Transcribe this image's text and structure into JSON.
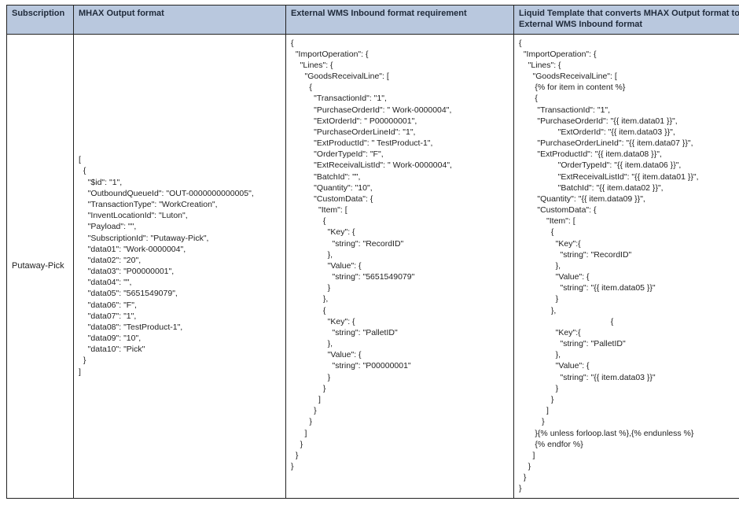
{
  "headers": {
    "col1": "Subscription",
    "col2": "MHAX Output format",
    "col3": "External WMS Inbound format requirement",
    "col4": "Liquid Template that converts MHAX Output format to External WMS Inbound format"
  },
  "row": {
    "subscription": "Putaway-Pick",
    "mhax": "[\n  {\n    \"$id\": \"1\",\n    \"OutboundQueueId\": \"OUT-0000000000005\",\n    \"TransactionType\": \"WorkCreation\",\n    \"InventLocationId\": \"Luton\",\n    \"Payload\": \"\",\n    \"SubscriptionId\": \"Putaway-Pick\",\n    \"data01\": \"Work-0000004\",\n    \"data02\": \"20\",\n    \"data03\": \"P00000001\",\n    \"data04\": \"\",\n    \"data05\": \"5651549079\",\n    \"data06\": \"F\",\n    \"data07\": \"1\",\n    \"data08\": \"TestProduct-1\",\n    \"data09\": \"10\",\n    \"data10\": \"Pick\"\n  }\n]",
    "external": "{\n  \"ImportOperation\": {\n    \"Lines\": {\n      \"GoodsReceivalLine\": [\n        {\n          \"TransactionId\": \"1\",\n          \"PurchaseOrderId\": \" Work-0000004\",\n          \"ExtOrderId\": \" P00000001\",\n          \"PurchaseOrderLineId\": \"1\",\n          \"ExtProductId\": \" TestProduct-1\",\n          \"OrderTypeId\": \"F\",\n          \"ExtReceivalListId\": \" Work-0000004\",\n          \"BatchId\": \"\",\n          \"Quantity\": \"10\",\n          \"CustomData\": {\n            \"Item\": [\n              {\n                \"Key\": {\n                  \"string\": \"RecordID\"\n                },\n                \"Value\": {\n                  \"string\": \"5651549079\"\n                }\n              },\n              {\n                \"Key\": {\n                  \"string\": \"PalletID\"\n                },\n                \"Value\": {\n                  \"string\": \"P00000001\"\n                }\n              }\n            ]\n          }\n        }\n      ]\n    }\n  }\n}",
    "liquid": "{\n  \"ImportOperation\": {\n    \"Lines\": {\n      \"GoodsReceivalLine\": [\n       {% for item in content %}\n       {\n        \"TransactionId\": \"1\",\n        \"PurchaseOrderId\": \"{{ item.data01 }}\",\n                 \"ExtOrderId\": \"{{ item.data03 }}\",\n        \"PurchaseOrderLineId\": \"{{ item.data07 }}\",\n        \"ExtProductId\": \"{{ item.data08 }}\",\n                 \"OrderTypeId\": \"{{ item.data06 }}\",\n                 \"ExtReceivalListId\": \"{{ item.data01 }}\",\n                 \"BatchId\": \"{{ item.data02 }}\",\n        \"Quantity\": \"{{ item.data09 }}\",\n        \"CustomData\": {\n            \"Item\": [\n              {\n                \"Key\":{\n                  \"string\": \"RecordID\"\n                },\n                \"Value\": {\n                  \"string\": \"{{ item.data05 }}\"\n                }\n              },\n                                        {\n                \"Key\":{\n                  \"string\": \"PalletID\"\n                },\n                \"Value\": {\n                  \"string\": \"{{ item.data03 }}\"\n                }\n              }\n            ]\n          }\n       }{% unless forloop.last %},{% endunless %}\n       {% endfor %}\n      ]\n    }\n  }\n}"
  }
}
